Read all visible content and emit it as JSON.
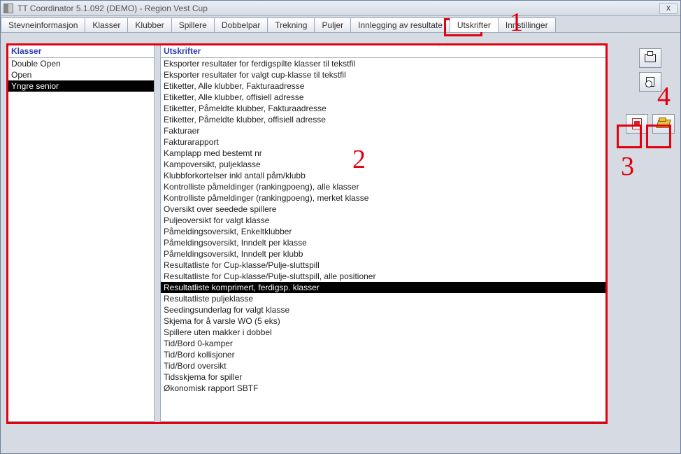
{
  "title": "TT Coordinator 5.1.092 (DEMO) - Region Vest Cup",
  "sys": {
    "close": "x"
  },
  "tabs": [
    {
      "label": "Stevneinformasjon"
    },
    {
      "label": "Klasser"
    },
    {
      "label": "Klubber"
    },
    {
      "label": "Spillere"
    },
    {
      "label": "Dobbelpar"
    },
    {
      "label": "Trekning"
    },
    {
      "label": "Puljer"
    },
    {
      "label": "Innlegging av resultate"
    },
    {
      "label": "Utskrifter",
      "active": true
    },
    {
      "label": "Innstillinger"
    }
  ],
  "columns": {
    "klasser": {
      "header": "Klasser",
      "items": [
        {
          "label": "Double Open"
        },
        {
          "label": "Open"
        },
        {
          "label": "Yngre senior",
          "selected": true
        }
      ]
    },
    "utskrifter": {
      "header": "Utskrifter",
      "items": [
        {
          "label": "Eksporter resultater for ferdigspilte klasser til tekstfil"
        },
        {
          "label": "Eksporter resultater for valgt cup-klasse til tekstfil"
        },
        {
          "label": "Etiketter, Alle klubber, Fakturaadresse"
        },
        {
          "label": "Etiketter, Alle klubber, offisiell adresse"
        },
        {
          "label": "Etiketter, Påmeldte klubber, Fakturaadresse"
        },
        {
          "label": "Etiketter, Påmeldte klubber, offisiell adresse"
        },
        {
          "label": "Fakturaer"
        },
        {
          "label": "Fakturarapport"
        },
        {
          "label": "Kamplapp med bestemt nr"
        },
        {
          "label": "Kampoversikt, puljeklasse"
        },
        {
          "label": "Klubbforkortelser inkl antall påm/klubb"
        },
        {
          "label": "Kontrolliste påmeldinger (rankingpoeng), alle klasser"
        },
        {
          "label": "Kontrolliste påmeldinger (rankingpoeng), merket klasse"
        },
        {
          "label": "Oversikt over seedede spillere"
        },
        {
          "label": "Puljeoversikt for valgt klasse"
        },
        {
          "label": "Påmeldingsoversikt, Enkeltklubber"
        },
        {
          "label": "Påmeldingsoversikt, Inndelt per klasse"
        },
        {
          "label": "Påmeldingsoversikt, Inndelt per klubb"
        },
        {
          "label": "Resultatliste for Cup-klasse/Pulje-sluttspill"
        },
        {
          "label": "Resultatliste for Cup-klasse/Pulje-sluttspill, alle positioner"
        },
        {
          "label": "Resultatliste komprimert, ferdigsp. klasser",
          "selected": true
        },
        {
          "label": "Resultatliste puljeklasse"
        },
        {
          "label": "Seedingsunderlag for valgt klasse"
        },
        {
          "label": "Skjema for å varsle WO (5 eks)"
        },
        {
          "label": "Spillere uten makker i dobbel"
        },
        {
          "label": "Tid/Bord 0-kamper"
        },
        {
          "label": "Tid/Bord kollisjoner"
        },
        {
          "label": "Tid/Bord oversikt"
        },
        {
          "label": "Tidsskjema for spiller"
        },
        {
          "label": "Økonomisk rapport SBTF"
        }
      ]
    }
  },
  "annotations": {
    "n1": "1",
    "n2": "2",
    "n3": "3",
    "n4": "4"
  }
}
